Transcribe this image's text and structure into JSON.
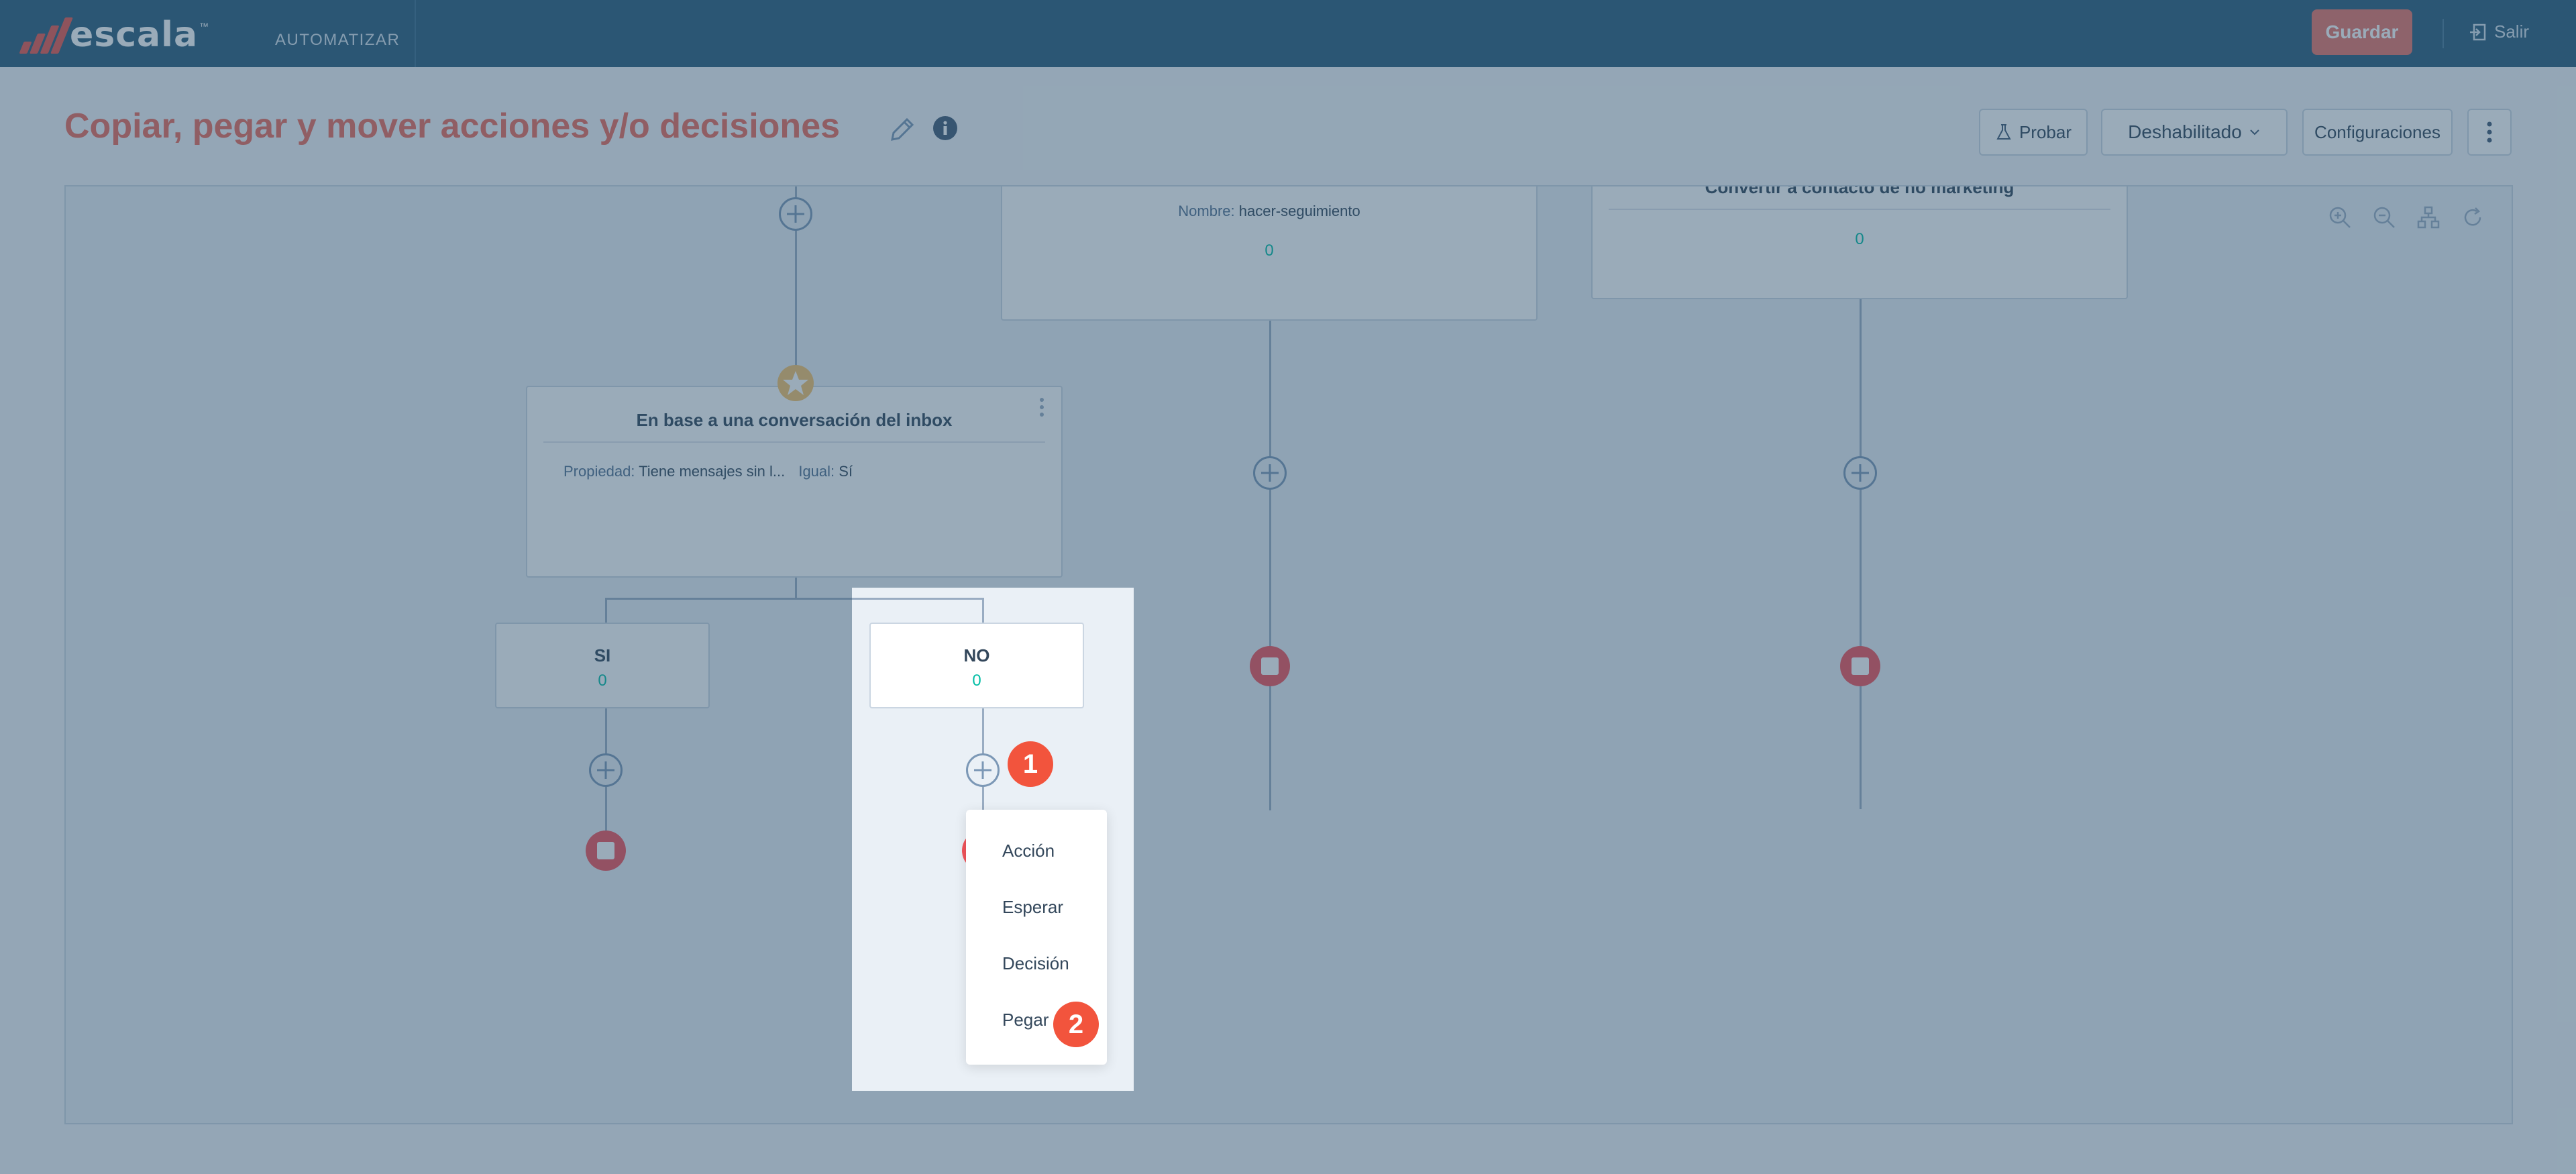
{
  "app": {
    "logo_text": "escala",
    "logo_tm": "™",
    "nav_label": "AUTOMATIZAR",
    "save_label": "Guardar",
    "exit_label": "Salir"
  },
  "header": {
    "title": "Copiar, pegar y mover acciones y/o decisiones",
    "test_label": "Probar",
    "status_label": "Deshabilitado",
    "settings_label": "Configuraciones"
  },
  "canvas": {
    "card_top_middle": {
      "prop_label": "Nombre:",
      "prop_value": "hacer-seguimiento",
      "count": "0"
    },
    "card_top_right": {
      "title": "Convertir a contacto de no marketing",
      "count": "0"
    },
    "decision_card": {
      "title": "En base a una conversación del inbox",
      "prop_label": "Propiedad:",
      "prop_value": "Tiene mensajes sin l...",
      "cond_label": "Igual:",
      "cond_value": "Sí"
    },
    "branch_yes": {
      "label": "SI",
      "count": "0"
    },
    "branch_no": {
      "label": "NO",
      "count": "0"
    }
  },
  "menu": {
    "items": [
      "Acción",
      "Esperar",
      "Decisión",
      "Pegar"
    ]
  },
  "annotations": {
    "step1": "1",
    "step2": "2"
  },
  "colors": {
    "topbar": "#2b5d7c",
    "accent": "#ec6c5c",
    "stop": "#f2545b",
    "count": "#00bda5",
    "badge": "#f2543d"
  }
}
